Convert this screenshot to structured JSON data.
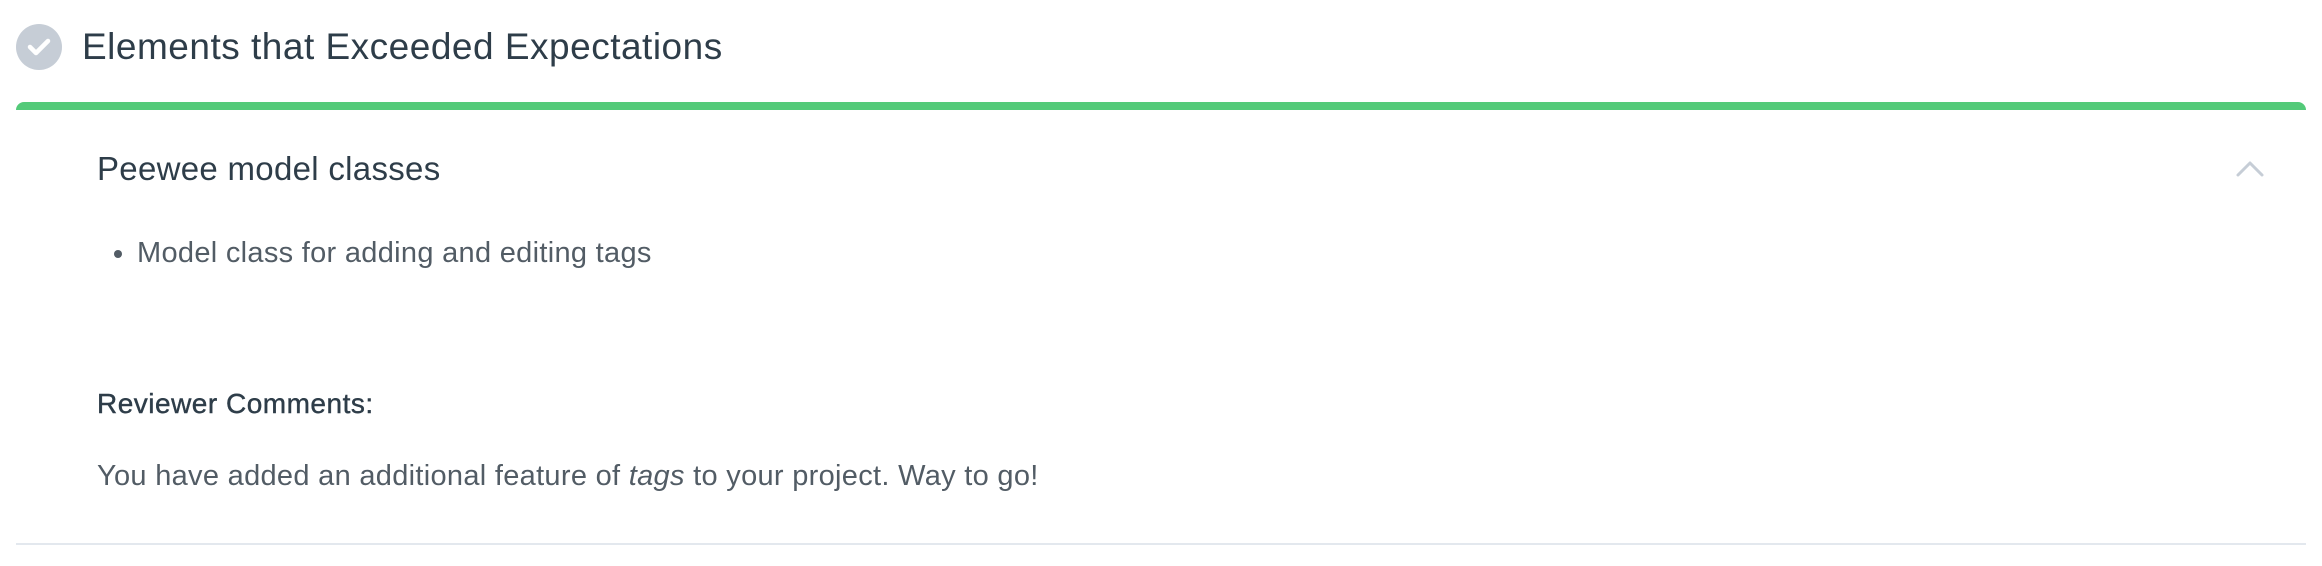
{
  "section": {
    "icon": "check-circle-icon",
    "title": "Elements that Exceeded Expectations"
  },
  "card": {
    "accent_color": "#53ca79",
    "criterion_title": "Peewee model classes",
    "collapse_icon": "chevron-up-icon",
    "bullets": [
      "Model class for adding and editing tags"
    ],
    "comments_label": "Reviewer Comments:",
    "comments": {
      "before": "You have added an additional feature of ",
      "emphasis": "tags",
      "after": " to your project. Way to go!"
    }
  }
}
